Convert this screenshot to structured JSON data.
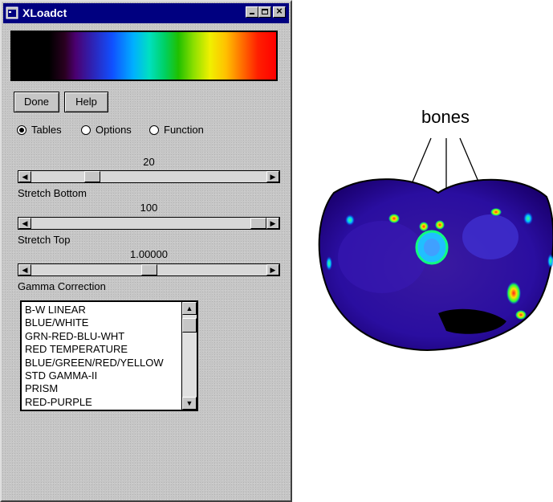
{
  "window": {
    "title": "XLoadct"
  },
  "buttons": {
    "done": "Done",
    "help": "Help"
  },
  "radios": [
    {
      "label": "Tables",
      "selected": true
    },
    {
      "label": "Options",
      "selected": false
    },
    {
      "label": "Function",
      "selected": false
    }
  ],
  "sliders": {
    "stretch_bottom": {
      "value": "20",
      "label": "Stretch Bottom",
      "position": 0.24
    },
    "stretch_top": {
      "value": "100",
      "label": "Stretch Top",
      "position": 1.0
    },
    "gamma": {
      "value": "1.00000",
      "label": "Gamma Correction",
      "position": 0.5
    }
  },
  "color_tables": [
    "B-W LINEAR",
    "BLUE/WHITE",
    "GRN-RED-BLU-WHT",
    "RED TEMPERATURE",
    "BLUE/GREEN/RED/YELLOW",
    "STD GAMMA-II",
    "PRISM",
    "RED-PURPLE"
  ],
  "annotation": {
    "label": "bones"
  },
  "icons": {
    "app": "app-icon",
    "minimize": "minimize-icon",
    "maximize": "maximize-icon",
    "close": "close-icon"
  }
}
